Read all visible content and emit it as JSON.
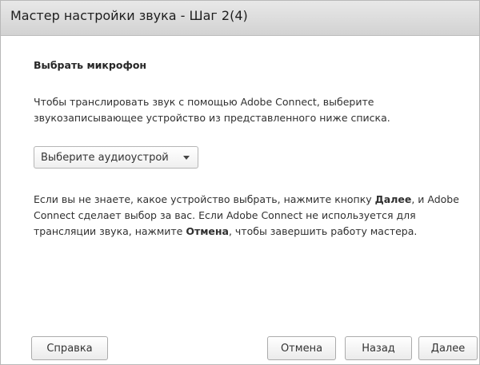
{
  "window": {
    "title": "Мастер настройки звука - Шаг 2(4)"
  },
  "content": {
    "heading": "Выбрать микрофон",
    "intro": "Чтобы транслировать звук с помощью Adobe Connect, выберите звукозаписывающее устройство из представленного ниже списка.",
    "device_select": {
      "selected": "Выберите аудиоустрой"
    },
    "help_text": {
      "part1": "Если вы не знаете, какое устройство выбрать, нажмите кнопку ",
      "next_word": "Далее",
      "part2": ", и Adobe Connect сделает выбор за вас. Если Adobe Connect не используется для трансляции звука, нажмите ",
      "cancel_word": "Отмена",
      "part3": ", чтобы завершить работу мастера."
    }
  },
  "buttons": {
    "help": "Справка",
    "cancel": "Отмена",
    "back": "Назад",
    "next": "Далее"
  },
  "icons": {
    "dropdown_arrow": "chevron-down-icon"
  }
}
